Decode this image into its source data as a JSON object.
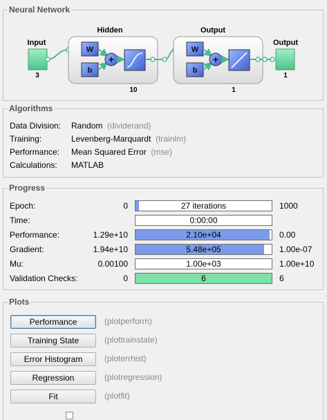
{
  "network": {
    "title": "Neural Network",
    "input_label": "Input",
    "input_size": "3",
    "hidden_label": "Hidden",
    "hidden_size": "10",
    "output_layer_label": "Output",
    "output_layer_size": "1",
    "output_label": "Output",
    "output_size": "1",
    "w": "W",
    "b": "b",
    "plus": "+"
  },
  "algorithms": {
    "title": "Algorithms",
    "rows": [
      {
        "label": "Data Division:",
        "value": "Random",
        "fn": "(dividerand)"
      },
      {
        "label": "Training:",
        "value": "Levenberg-Marquardt",
        "fn": "(trainlm)"
      },
      {
        "label": "Performance:",
        "value": "Mean Squared Error",
        "fn": "(mse)"
      },
      {
        "label": "Calculations:",
        "value": "MATLAB",
        "fn": ""
      }
    ]
  },
  "progress": {
    "title": "Progress",
    "rows": [
      {
        "label": "Epoch:",
        "start": "0",
        "bar_text": "27 iterations",
        "end": "1000",
        "fill": 0.027,
        "color": "#7b9bea"
      },
      {
        "label": "Time:",
        "start": "",
        "bar_text": "0:00:00",
        "end": "",
        "fill": 0,
        "color": "#7b9bea"
      },
      {
        "label": "Performance:",
        "start": "1.29e+10",
        "bar_text": "2.10e+04",
        "end": "0.00",
        "fill": 0.985,
        "color": "#7b9bea"
      },
      {
        "label": "Gradient:",
        "start": "1.94e+10",
        "bar_text": "5.48e+05",
        "end": "1.00e-07",
        "fill": 0.945,
        "color": "#7b9bea"
      },
      {
        "label": "Mu:",
        "start": "0.00100",
        "bar_text": "1.00e+03",
        "end": "1.00e+10",
        "fill": 0,
        "color": "#7b9bea"
      },
      {
        "label": "Validation Checks:",
        "start": "0",
        "bar_text": "6",
        "end": "6",
        "fill": 1.0,
        "color": "#7ee0a8"
      }
    ]
  },
  "plots": {
    "title": "Plots",
    "buttons": [
      {
        "label": "Performance",
        "fn": "(plotperform)"
      },
      {
        "label": "Training State",
        "fn": "(plottrainstate)"
      },
      {
        "label": "Error Histogram",
        "fn": "(ploterrhist)"
      },
      {
        "label": "Regression",
        "fn": "(plotregression)"
      },
      {
        "label": "Fit",
        "fn": "(plotfit)"
      }
    ]
  },
  "colors": {
    "accent_blue": "#7b9bea",
    "green": "#7ee0a8",
    "node": "#5bc7a0"
  }
}
